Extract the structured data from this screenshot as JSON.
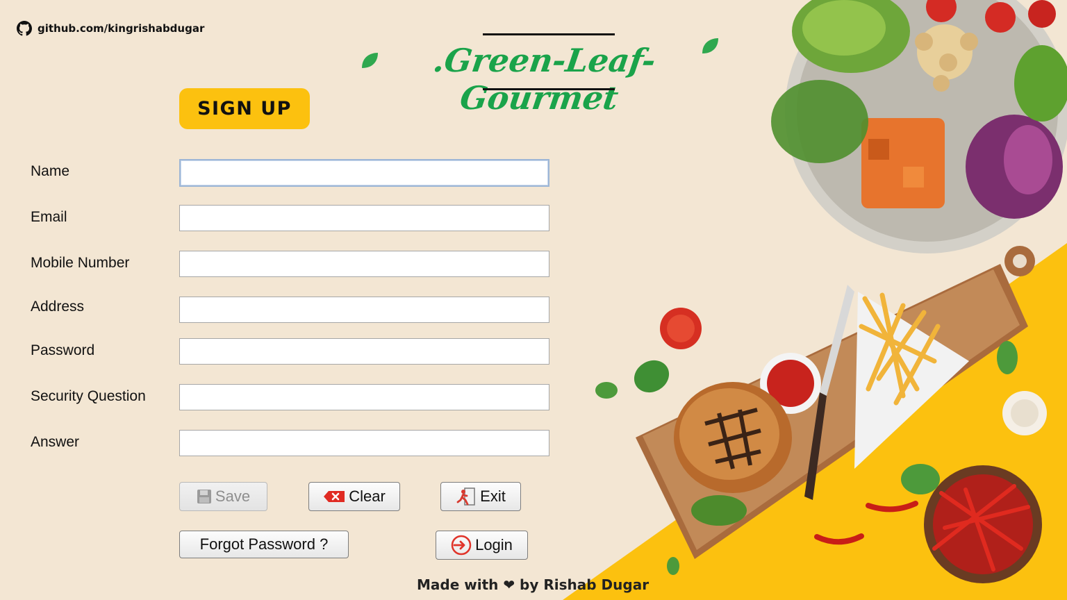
{
  "header": {
    "github_text": "github.com/kingrishabdugar",
    "brand": ".Green-Leaf-Gourmet",
    "signup_title": "SIGN UP"
  },
  "form": {
    "fields": [
      {
        "label": "Name",
        "value": ""
      },
      {
        "label": "Email",
        "value": ""
      },
      {
        "label": "Mobile Number",
        "value": ""
      },
      {
        "label": "Address",
        "value": ""
      },
      {
        "label": "Password",
        "value": ""
      },
      {
        "label": "Security Question",
        "value": ""
      },
      {
        "label": "Answer",
        "value": ""
      }
    ]
  },
  "buttons": {
    "save": "Save",
    "clear": "Clear",
    "exit": "Exit",
    "forgot": "Forgot Password ?",
    "login": "Login"
  },
  "footer": {
    "text": "Made with ❤ by Rishab Dugar"
  },
  "colors": {
    "background": "#f3e6d3",
    "accent_yellow": "#fcc10f",
    "brand_green": "#1aa34a"
  },
  "icons": [
    "github-icon",
    "leaf-icon",
    "save-icon",
    "clear-icon",
    "exit-icon",
    "login-icon"
  ]
}
